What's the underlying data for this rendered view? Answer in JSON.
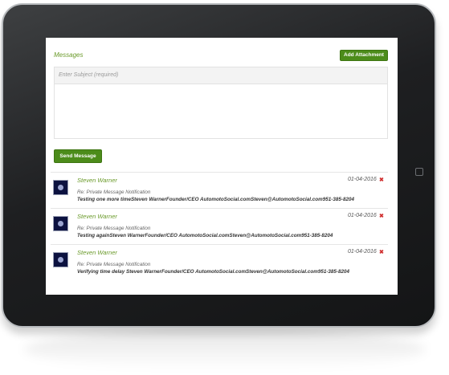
{
  "messages": {
    "title": "Messages",
    "add_attachment_label": "Add Attachment",
    "subject_placeholder": "Enter Subject (required)",
    "send_label": "Send Message",
    "items": [
      {
        "sender": "Steven Warner",
        "date": "01-04-2016",
        "subject": "Re: Private Message Notification",
        "preview": "Testing one more timeSteven WarnerFounder/CEO AutomotoSocial.comSteven@AutomotoSocial.com951-385-8204"
      },
      {
        "sender": "Steven Warner",
        "date": "01-04-2016",
        "subject": "Re: Private Message Notification",
        "preview": "Testing againSteven WarnerFounder/CEO AutomotoSocial.comSteven@AutomotoSocial.com951-385-8204"
      },
      {
        "sender": "Steven Warner",
        "date": "01-04-2016",
        "subject": "Re: Private Message Notification",
        "preview": "Verifying time delay Steven WarnerFounder/CEO AutomotoSocial.comSteven@AutomotoSocial.com951-385-8204"
      }
    ]
  },
  "icons": {
    "delete": "close-icon"
  },
  "colors": {
    "accent_green": "#4c8c1a",
    "title_green": "#6a9a2a",
    "delete_red": "#d03030"
  }
}
